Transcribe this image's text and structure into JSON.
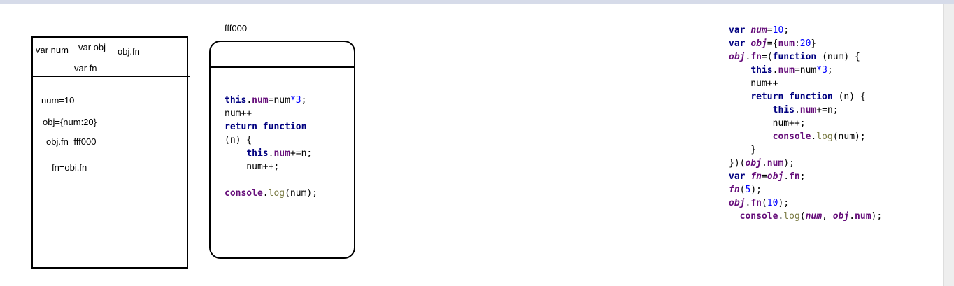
{
  "scope": {
    "headers": {
      "var_num": "var num",
      "var_obj": "var obj",
      "obj_fn": "obj.fn",
      "var_fn": "var fn"
    },
    "values": {
      "num": "num=10",
      "obj": "obj={num:20}",
      "obj_fn": "obj.fn=fff000",
      "fn": "fn=obi.fn"
    }
  },
  "heap": {
    "address": "fff000",
    "lines": [
      [
        {
          "t": "this",
          "c": "kw"
        },
        {
          "t": ".",
          "c": "pl"
        },
        {
          "t": "num",
          "c": "prop"
        },
        {
          "t": "=num",
          "c": "pl"
        },
        {
          "t": "*3",
          "c": "num"
        },
        {
          "t": ";",
          "c": "pl"
        }
      ],
      [
        {
          "t": "num++",
          "c": "pl"
        }
      ],
      [
        {
          "t": "return function",
          "c": "kw"
        }
      ],
      [
        {
          "t": "(n) {",
          "c": "pl"
        }
      ],
      [
        {
          "t": "    ",
          "c": "pl"
        },
        {
          "t": "this",
          "c": "kw"
        },
        {
          "t": ".",
          "c": "pl"
        },
        {
          "t": "num",
          "c": "prop"
        },
        {
          "t": "+=n;",
          "c": "pl"
        }
      ],
      [
        {
          "t": "    num++;",
          "c": "pl"
        }
      ],
      [
        {
          "t": "",
          "c": "pl"
        }
      ],
      [
        {
          "t": "console",
          "c": "prop"
        },
        {
          "t": ".",
          "c": "pl"
        },
        {
          "t": "log",
          "c": "fn"
        },
        {
          "t": "(num);",
          "c": "pl"
        }
      ]
    ]
  },
  "source": {
    "lines": [
      [
        {
          "t": "var ",
          "c": "kw"
        },
        {
          "t": "num",
          "c": "gv"
        },
        {
          "t": "=",
          "c": "pl"
        },
        {
          "t": "10",
          "c": "num"
        },
        {
          "t": ";",
          "c": "pl"
        }
      ],
      [
        {
          "t": "var ",
          "c": "kw"
        },
        {
          "t": "obj",
          "c": "gv"
        },
        {
          "t": "={",
          "c": "pl"
        },
        {
          "t": "num",
          "c": "prop"
        },
        {
          "t": ":",
          "c": "pl"
        },
        {
          "t": "20",
          "c": "num"
        },
        {
          "t": "}",
          "c": "pl"
        }
      ],
      [
        {
          "t": "obj",
          "c": "gv"
        },
        {
          "t": ".",
          "c": "pl"
        },
        {
          "t": "fn",
          "c": "prop"
        },
        {
          "t": "=(",
          "c": "pl"
        },
        {
          "t": "function",
          "c": "kw"
        },
        {
          "t": " (num) {",
          "c": "pl"
        }
      ],
      [
        {
          "t": "    ",
          "c": "pl"
        },
        {
          "t": "this",
          "c": "kw"
        },
        {
          "t": ".",
          "c": "pl"
        },
        {
          "t": "num",
          "c": "prop"
        },
        {
          "t": "=num",
          "c": "pl"
        },
        {
          "t": "*3",
          "c": "num"
        },
        {
          "t": ";",
          "c": "pl"
        }
      ],
      [
        {
          "t": "    num++",
          "c": "pl"
        }
      ],
      [
        {
          "t": "    ",
          "c": "pl"
        },
        {
          "t": "return function",
          "c": "kw"
        },
        {
          "t": " (n) {",
          "c": "pl"
        }
      ],
      [
        {
          "t": "        ",
          "c": "pl"
        },
        {
          "t": "this",
          "c": "kw"
        },
        {
          "t": ".",
          "c": "pl"
        },
        {
          "t": "num",
          "c": "prop"
        },
        {
          "t": "+=n;",
          "c": "pl"
        }
      ],
      [
        {
          "t": "        num++;",
          "c": "pl"
        }
      ],
      [
        {
          "t": "        ",
          "c": "pl"
        },
        {
          "t": "console",
          "c": "prop"
        },
        {
          "t": ".",
          "c": "pl"
        },
        {
          "t": "log",
          "c": "fn"
        },
        {
          "t": "(num);",
          "c": "pl"
        }
      ],
      [
        {
          "t": "    }",
          "c": "pl"
        }
      ],
      [
        {
          "t": "})(",
          "c": "pl"
        },
        {
          "t": "obj",
          "c": "gv"
        },
        {
          "t": ".",
          "c": "pl"
        },
        {
          "t": "num",
          "c": "prop"
        },
        {
          "t": ");",
          "c": "pl"
        }
      ],
      [
        {
          "t": "var ",
          "c": "kw"
        },
        {
          "t": "fn",
          "c": "gv"
        },
        {
          "t": "=",
          "c": "pl"
        },
        {
          "t": "obj",
          "c": "gv"
        },
        {
          "t": ".",
          "c": "pl"
        },
        {
          "t": "fn",
          "c": "prop"
        },
        {
          "t": ";",
          "c": "pl"
        }
      ],
      [
        {
          "t": "fn",
          "c": "gv"
        },
        {
          "t": "(",
          "c": "pl"
        },
        {
          "t": "5",
          "c": "num"
        },
        {
          "t": ");",
          "c": "pl"
        }
      ],
      [
        {
          "t": "obj",
          "c": "gv"
        },
        {
          "t": ".",
          "c": "pl"
        },
        {
          "t": "fn",
          "c": "prop"
        },
        {
          "t": "(",
          "c": "pl"
        },
        {
          "t": "10",
          "c": "num"
        },
        {
          "t": ");",
          "c": "pl"
        }
      ],
      [
        {
          "t": "  ",
          "c": "pl"
        },
        {
          "t": "console",
          "c": "prop"
        },
        {
          "t": ".",
          "c": "pl"
        },
        {
          "t": "log",
          "c": "fn"
        },
        {
          "t": "(",
          "c": "pl"
        },
        {
          "t": "num",
          "c": "gv"
        },
        {
          "t": ", ",
          "c": "pl"
        },
        {
          "t": "obj",
          "c": "gv"
        },
        {
          "t": ".",
          "c": "pl"
        },
        {
          "t": "num",
          "c": "prop"
        },
        {
          "t": ");",
          "c": "pl"
        }
      ]
    ]
  }
}
